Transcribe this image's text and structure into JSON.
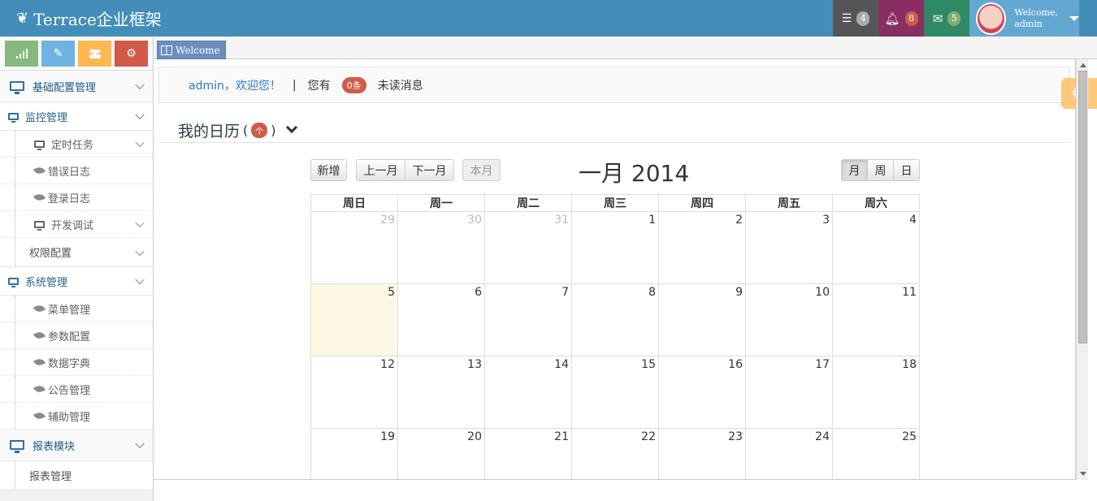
{
  "header": {
    "brand": "Terrace企业框架",
    "tasks_badge": "4",
    "notifications_badge": "8",
    "messages_badge": "5",
    "welcome_line1": "Welcome,",
    "welcome_line2": "admin"
  },
  "sidebar": {
    "shortcuts": [
      "stats-icon",
      "pencil-icon",
      "users-icon",
      "cogs-icon"
    ],
    "menu": {
      "basic_config": "基础配置管理",
      "monitor": "监控管理",
      "scheduled_tasks": "定时任务",
      "error_log": "错误日志",
      "login_log": "登录日志",
      "dev_debug": "开发调试",
      "permission_config": "权限配置",
      "system_mgmt": "系统管理",
      "menu_mgmt": "菜单管理",
      "param_config": "参数配置",
      "data_dict": "数据字典",
      "notice_mgmt": "公告管理",
      "aux_mgmt": "辅助管理",
      "report_module": "报表模块",
      "report_mgmt": "报表管理"
    }
  },
  "tabs": [
    {
      "label": "Welcome"
    }
  ],
  "alert": {
    "greeting": "admin，欢迎您！",
    "separator": "|",
    "you_have": "您有",
    "count": "0条",
    "unread": "未读消息"
  },
  "calendar": {
    "heading": "我的日历",
    "heading_paren_open": "(",
    "heading_badge": "个",
    "heading_paren_close": ")",
    "buttons": {
      "add": "新增",
      "prev_month": "上一月",
      "next_month": "下一月",
      "this_month": "本月",
      "view_month": "月",
      "view_week": "周",
      "view_day": "日"
    },
    "title": "一月 2014",
    "weekdays": [
      "周日",
      "周一",
      "周二",
      "周三",
      "周四",
      "周五",
      "周六"
    ],
    "weeks": [
      [
        "29",
        "30",
        "31",
        "1",
        "2",
        "3",
        "4"
      ],
      [
        "5",
        "6",
        "7",
        "8",
        "9",
        "10",
        "11"
      ],
      [
        "12",
        "13",
        "14",
        "15",
        "16",
        "17",
        "18"
      ],
      [
        "19",
        "20",
        "21",
        "22",
        "23",
        "24",
        "25"
      ]
    ]
  },
  "colors": {
    "navbar": "#438eb9",
    "today_highlight": "#fcf8e3",
    "badge_red": "#d15b47"
  }
}
